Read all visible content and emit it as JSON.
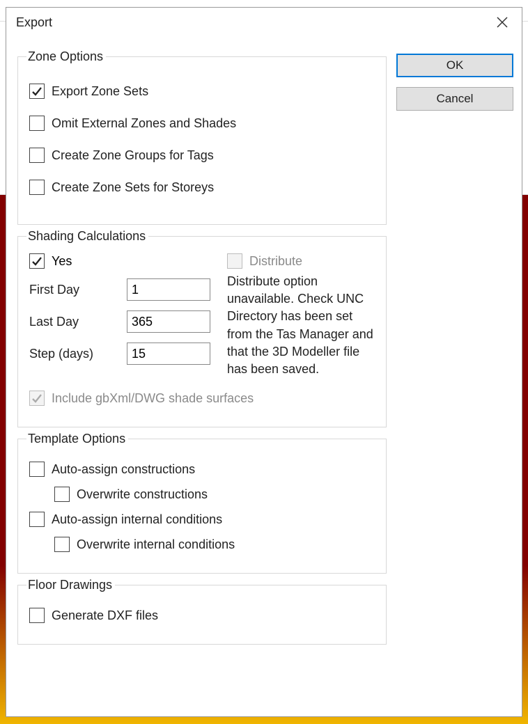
{
  "dialog": {
    "title": "Export"
  },
  "buttons": {
    "ok": "OK",
    "cancel": "Cancel"
  },
  "zone_options": {
    "legend": "Zone Options",
    "export_zone_sets": "Export Zone Sets",
    "omit_external": "Omit External Zones and Shades",
    "create_groups_tags": "Create Zone Groups for Tags",
    "create_sets_storeys": "Create Zone Sets for Storeys"
  },
  "shading": {
    "legend": "Shading Calculations",
    "yes": "Yes",
    "distribute": "Distribute",
    "first_day_label": "First Day",
    "first_day_value": "1",
    "last_day_label": "Last Day",
    "last_day_value": "365",
    "step_label": "Step (days)",
    "step_value": "15",
    "include_gbxml": "Include gbXml/DWG shade surfaces",
    "distribute_info": "Distribute option unavailable. Check UNC Directory has been set from the Tas Manager and that the 3D Modeller file has been saved."
  },
  "template_options": {
    "legend": "Template Options",
    "auto_constructions": "Auto-assign constructions",
    "overwrite_constructions": "Overwrite constructions",
    "auto_internal": "Auto-assign internal conditions",
    "overwrite_internal": "Overwrite internal conditions"
  },
  "floor_drawings": {
    "legend": "Floor Drawings",
    "generate_dxf": "Generate DXF files"
  }
}
